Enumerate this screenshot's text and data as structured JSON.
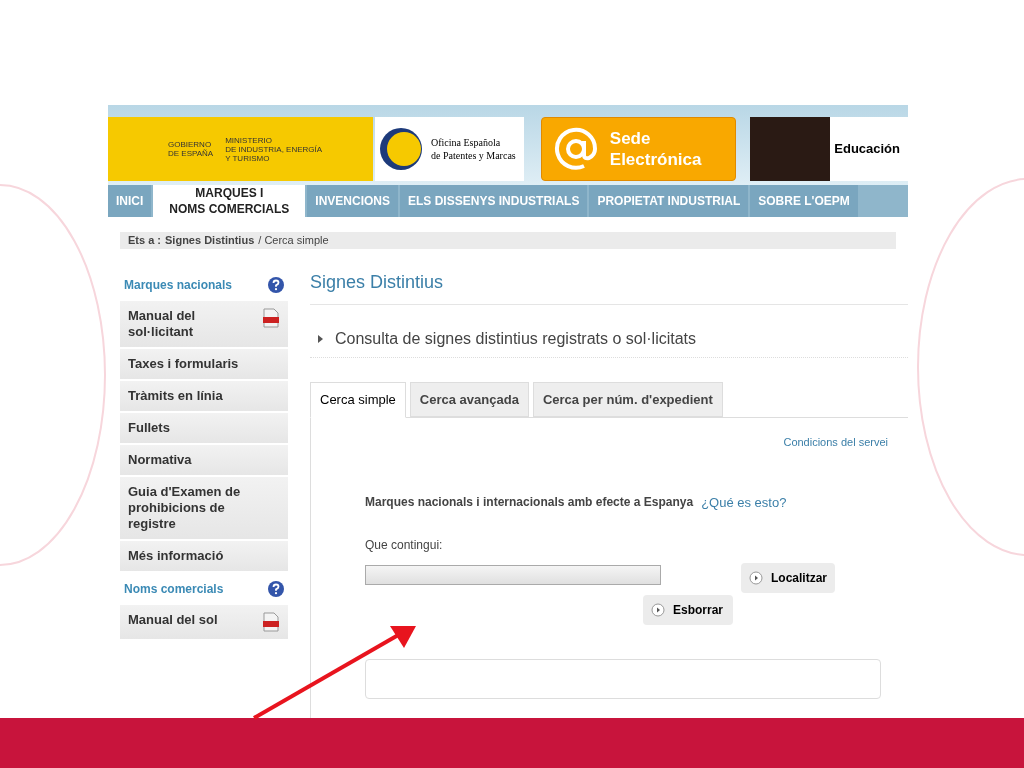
{
  "header": {
    "gov_label": "GOBIERNO\nDE ESPAÑA",
    "ministry_label": "MINISTERIO\nDE INDUSTRIA, ENERGÍA\nY TURISMO",
    "office_label": "Oficina Española\nde Patentes y Marcas",
    "sede_label": "Sede\nElectrónica",
    "education_label": "Educación"
  },
  "nav": [
    {
      "label": "INICI",
      "selected": false
    },
    {
      "label": "MARQUES I\nNOMS COMERCIALS",
      "selected": true
    },
    {
      "label": "INVENCIONS",
      "selected": false
    },
    {
      "label": "ELS DISSENYS INDUSTRIALS",
      "selected": false
    },
    {
      "label": "PROPIETAT INDUSTRIAL",
      "selected": false
    },
    {
      "label": "SOBRE L'OEPM",
      "selected": false
    }
  ],
  "breadcrumb": {
    "prefix": "Ets a :",
    "items": [
      "Signes Distintius",
      "/ Cerca simple"
    ]
  },
  "sidebar": [
    {
      "title": "Marques nacionals",
      "items": [
        {
          "label": "Manual del\nsol·licitant",
          "kind": "pdf"
        },
        {
          "label": "Taxes i formularis",
          "kind": "link"
        },
        {
          "label": "Tràmits en línia",
          "kind": "link"
        },
        {
          "label": "Fullets",
          "kind": "link"
        },
        {
          "label": "Normativa",
          "kind": "link"
        },
        {
          "label": "Guia d'Examen de\nprohibicions de\nregistre",
          "kind": "link"
        },
        {
          "label": "Més informació",
          "kind": "link"
        }
      ]
    },
    {
      "title": "Noms comercials",
      "items": [
        {
          "label": "Manual del sol",
          "kind": "pdf"
        }
      ]
    }
  ],
  "main": {
    "title": "Signes Distintius",
    "section": "Consulta de signes distintius registrats o sol·licitats",
    "tabs": [
      {
        "label": "Cerca simple",
        "selected": true
      },
      {
        "label": "Cerca avançada",
        "selected": false
      },
      {
        "label": "Cerca per núm. d'expedient",
        "selected": false
      }
    ],
    "terms_link": "Condicions del servei",
    "scope": "Marques nacionals i internacionals amb efecte a Espanya",
    "help_link": "¿Qué es esto?",
    "field_label": "Que contingui:",
    "search_button": "Localitzar",
    "clear_button": "Esborrar"
  }
}
